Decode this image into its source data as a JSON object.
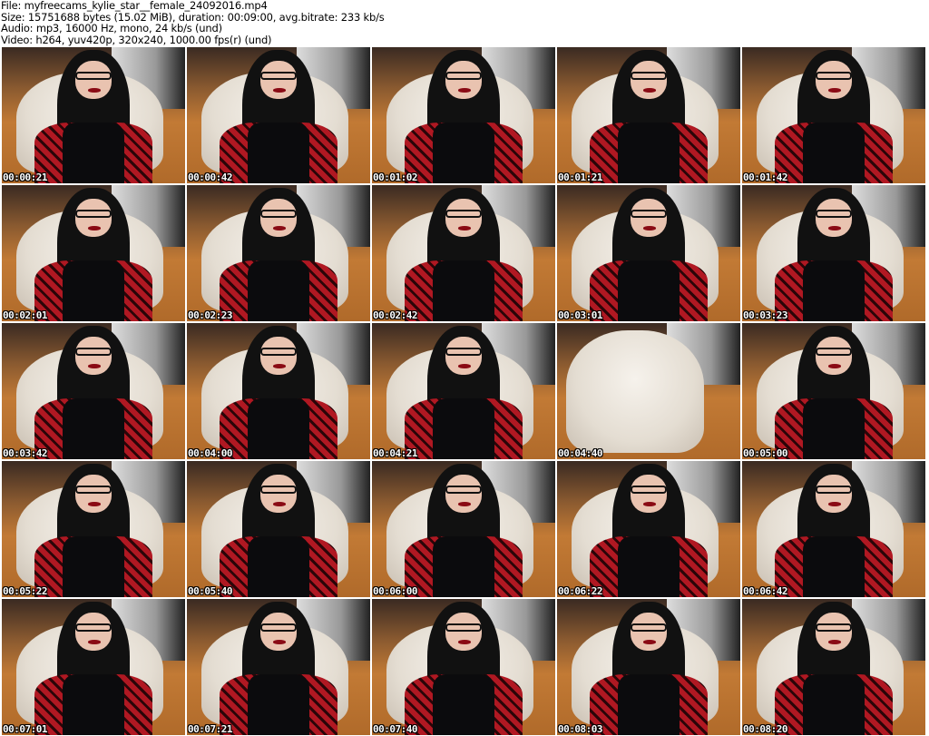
{
  "info": {
    "file": "File: myfreecams_kylie_star__female_24092016.mp4",
    "size": "Size: 15751688 bytes (15.02 MiB), duration: 00:09:00, avg.bitrate: 233 kb/s",
    "audio": "Audio: mp3, 16000 Hz, mono, 24 kb/s (und)",
    "video": "Video: h264, yuv420p, 320x240, 1000.00 fps(r) (und)"
  },
  "thumbnails": [
    {
      "timestamp": "00:00:21"
    },
    {
      "timestamp": "00:00:42"
    },
    {
      "timestamp": "00:01:02"
    },
    {
      "timestamp": "00:01:21"
    },
    {
      "timestamp": "00:01:42"
    },
    {
      "timestamp": "00:02:01"
    },
    {
      "timestamp": "00:02:23"
    },
    {
      "timestamp": "00:02:42"
    },
    {
      "timestamp": "00:03:01"
    },
    {
      "timestamp": "00:03:23"
    },
    {
      "timestamp": "00:03:42"
    },
    {
      "timestamp": "00:04:00"
    },
    {
      "timestamp": "00:04:21"
    },
    {
      "timestamp": "00:04:40"
    },
    {
      "timestamp": "00:05:00"
    },
    {
      "timestamp": "00:05:22"
    },
    {
      "timestamp": "00:05:40"
    },
    {
      "timestamp": "00:06:00"
    },
    {
      "timestamp": "00:06:22"
    },
    {
      "timestamp": "00:06:42"
    },
    {
      "timestamp": "00:07:01"
    },
    {
      "timestamp": "00:07:21"
    },
    {
      "timestamp": "00:07:40"
    },
    {
      "timestamp": "00:08:03"
    },
    {
      "timestamp": "00:08:20"
    }
  ]
}
